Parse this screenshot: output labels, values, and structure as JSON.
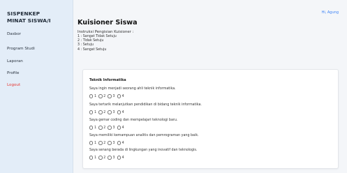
{
  "sidebar": {
    "brand_line1": "SISPENKEP",
    "brand_line2": "MINAT SISWA/I",
    "items": [
      {
        "label": "Dasbor"
      },
      {
        "label": "Program Studi"
      },
      {
        "label": "Laporan"
      },
      {
        "label": "Profile"
      },
      {
        "label": "Logout"
      }
    ]
  },
  "header": {
    "greeting": "Hi, Agung"
  },
  "page": {
    "title": "Kuisioner Siswa",
    "instructions_title": "Instruksi Pengisian Kuisioner :",
    "scale": [
      "1 : Sangat Tidak Setuju",
      "2 : Tidak Setuju",
      "3 : Setuju",
      "4 : Sangat Setuju"
    ]
  },
  "section": {
    "title": "Teknik Informatika",
    "options": [
      "1",
      "2",
      "3",
      "4"
    ],
    "questions": [
      "Saya ingin menjadi seorang ahli teknik informatika.",
      "Saya tertarik melanjutkan pendidikan di bidang teknik informatika.",
      "Saya gemar coding dan mempelajari teknologi baru.",
      "Saya memiliki kemampuan analitis dan pemrograman yang baik.",
      "Saya senang berada di lingkungan yang inovatif dan teknologis."
    ]
  },
  "colors": {
    "sidebar_bg": "#e3edf8",
    "logout": "#e53935",
    "greeting": "#3b82f6"
  }
}
